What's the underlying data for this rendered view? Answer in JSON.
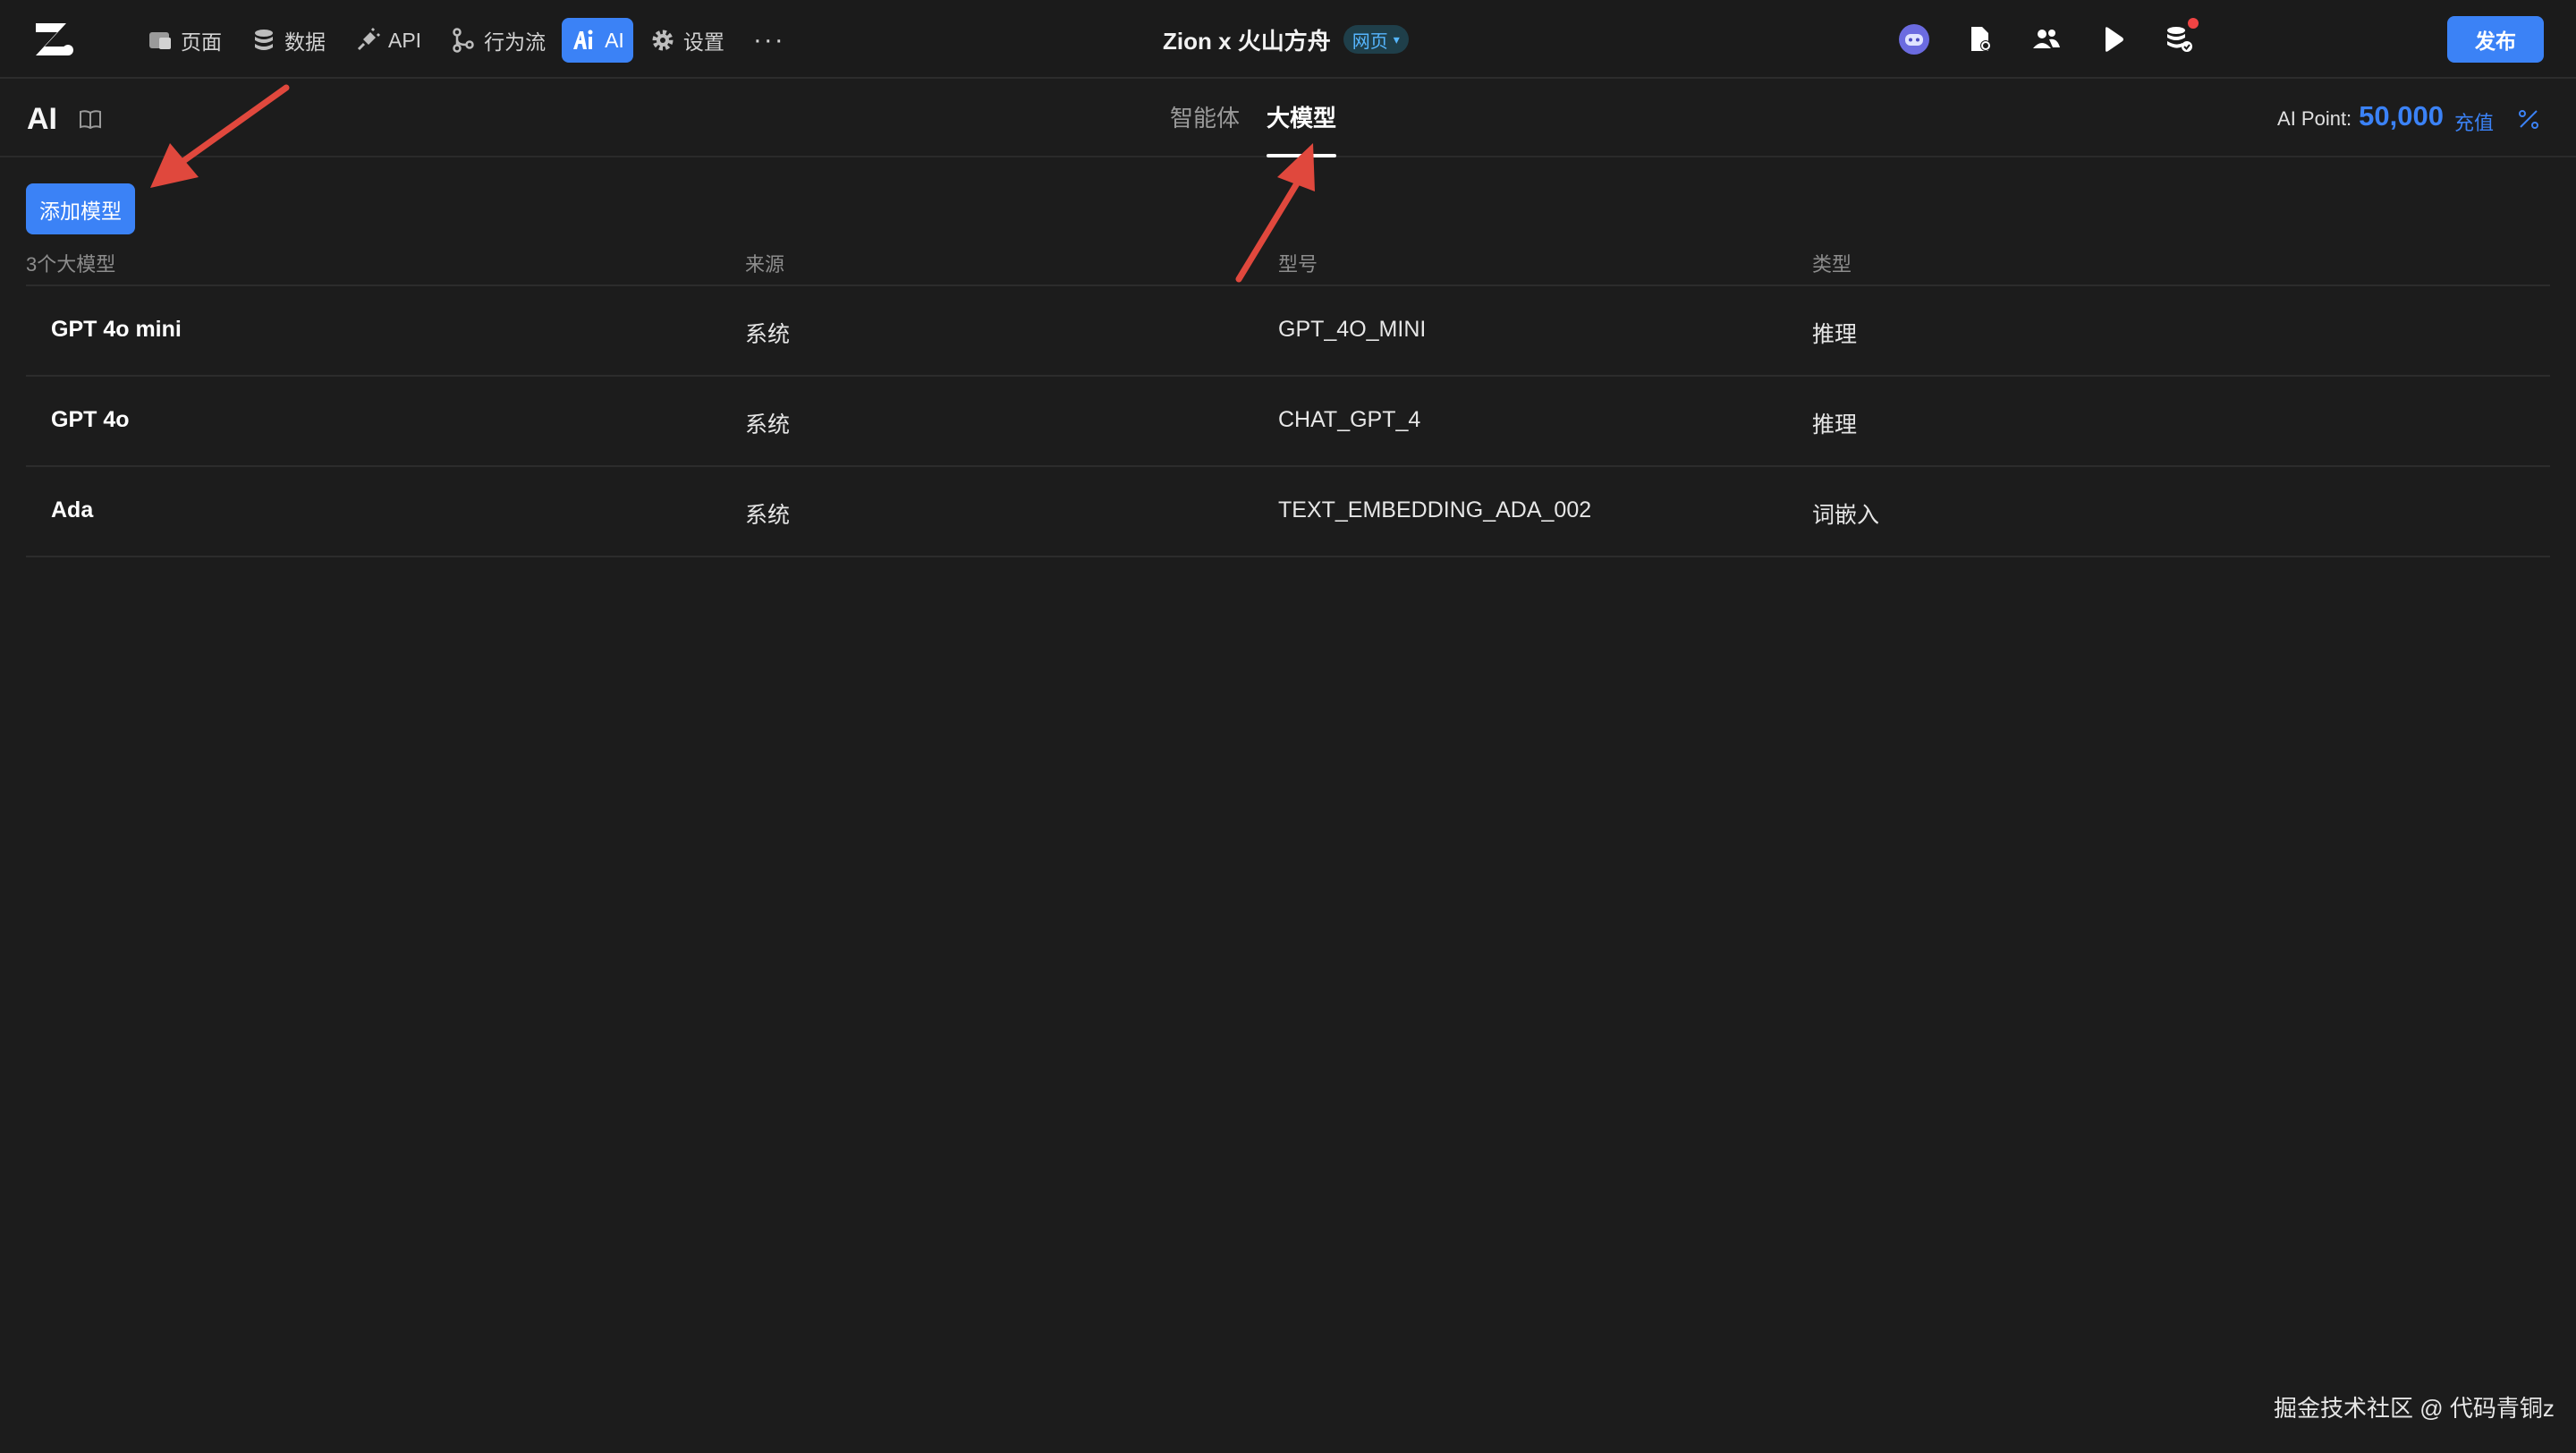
{
  "topbar": {
    "nav": [
      {
        "label": "页面",
        "icon": "page-icon"
      },
      {
        "label": "数据",
        "icon": "database-icon"
      },
      {
        "label": "API",
        "icon": "api-plug-icon"
      },
      {
        "label": "行为流",
        "icon": "flow-icon"
      },
      {
        "label": "AI",
        "icon": "ai-icon",
        "active": true
      },
      {
        "label": "设置",
        "icon": "gear-icon"
      }
    ],
    "more_label": "···",
    "project_name": "Zion x 火山方舟",
    "project_badge": "网页",
    "publish_label": "发布",
    "accent": "#3b82f6"
  },
  "subheader": {
    "title": "AI",
    "tabs": [
      "智能体",
      "大模型"
    ],
    "active_tab": "大模型",
    "points_label": "AI Point:",
    "points_value": "50,000",
    "recharge_label": "充值"
  },
  "main": {
    "add_button": "添加模型",
    "columns": [
      "3个大模型",
      "来源",
      "型号",
      "类型"
    ],
    "rows": [
      {
        "name": "GPT 4o mini",
        "source": "系统",
        "model": "GPT_4O_MINI",
        "type": "推理"
      },
      {
        "name": "GPT 4o",
        "source": "系统",
        "model": "CHAT_GPT_4",
        "type": "推理"
      },
      {
        "name": "Ada",
        "source": "系统",
        "model": "TEXT_EMBEDDING_ADA_002",
        "type": "词嵌入"
      }
    ]
  },
  "watermark": "掘金技术社区 @ 代码青铜z"
}
